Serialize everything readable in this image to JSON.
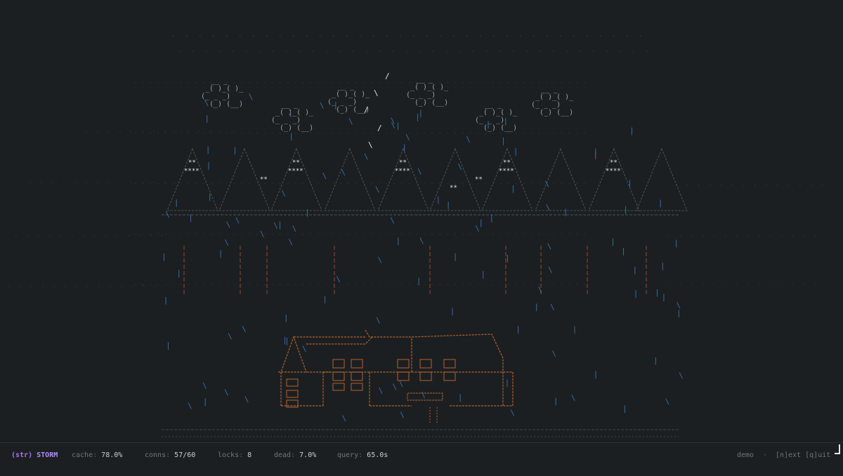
{
  "status_bar": {
    "mode_tag": "(str)",
    "mode_name": "STORM",
    "metrics": [
      {
        "label": "cache",
        "value": "78.0%"
      },
      {
        "label": "conns",
        "value": "57/60"
      },
      {
        "label": "locks",
        "value": "8"
      },
      {
        "label": "dead",
        "value": "7.0%"
      },
      {
        "label": "query",
        "value": "65.0s"
      }
    ],
    "session": "demo",
    "separator": "·",
    "actions": "[n]ext [q]uit"
  },
  "scene": {
    "description_none": "",
    "colors": {
      "background": "#1b1f21",
      "rain": "#3a6ea8",
      "cloud": "#9aa4ab",
      "lightning": "#e6e6e6",
      "tree": "#4a5560",
      "snow": "#e0e0e0",
      "house": "#b5622e",
      "trunk": "#5a3326",
      "ground": "#3e464c",
      "mist": "#2f3539"
    }
  }
}
